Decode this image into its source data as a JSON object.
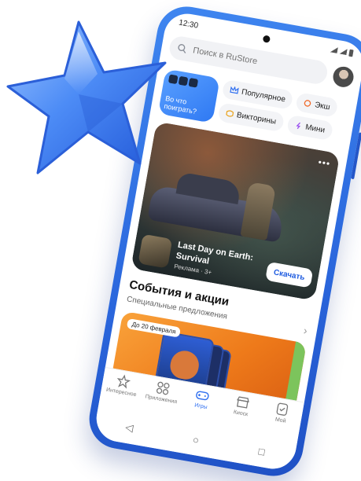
{
  "status": {
    "time": "12:30"
  },
  "search": {
    "placeholder": "Поиск в RuStore"
  },
  "hero_chip": {
    "label": "Во что поиграть?"
  },
  "chips": [
    {
      "label": "Популярное",
      "icon": "crown-icon"
    },
    {
      "label": "Экш",
      "icon": "action-icon"
    },
    {
      "label": "Викторины",
      "icon": "quiz-icon"
    },
    {
      "label": "Мини",
      "icon": "mini-icon"
    }
  ],
  "ad": {
    "title": "Last Day on Earth: Survival",
    "meta": "Реклама · 3+",
    "button": "Скачать",
    "more": "•••"
  },
  "section": {
    "title": "События и акции",
    "subtitle": "Специальные предложения"
  },
  "promo": {
    "badge": "До 20 февраля"
  },
  "tabs": [
    {
      "label": "Интересное",
      "icon": "star-outline-icon",
      "active": false
    },
    {
      "label": "Приложения",
      "icon": "apps-icon",
      "active": false
    },
    {
      "label": "Игры",
      "icon": "gamepad-icon",
      "active": true
    },
    {
      "label": "Киоск",
      "icon": "kiosk-icon",
      "active": false
    },
    {
      "label": "Мой",
      "icon": "profile-icon",
      "active": false
    }
  ],
  "colors": {
    "phone": "#2f6ff0",
    "accent": "#2f6ff0",
    "star": "#4e8cf4"
  }
}
